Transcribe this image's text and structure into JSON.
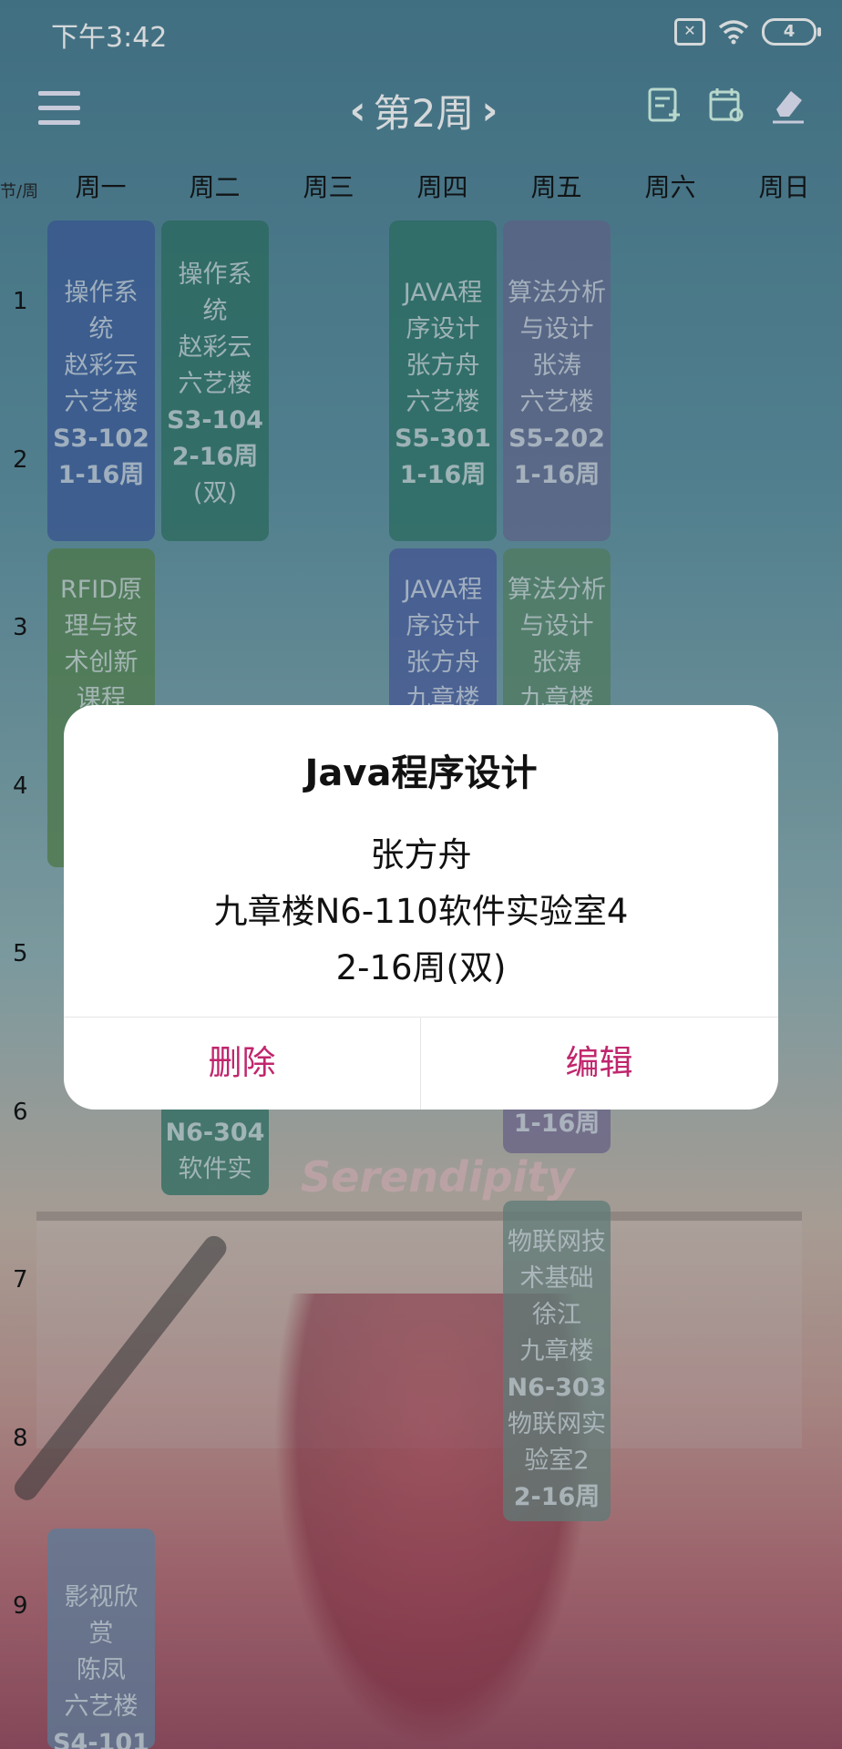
{
  "status_bar": {
    "time": "下午3:42",
    "sim_icon": "sim-off-icon",
    "battery_level": "4"
  },
  "toolbar": {
    "week_label": "第2周"
  },
  "grid": {
    "corner_label": "节/周",
    "days": [
      "周一",
      "周二",
      "周三",
      "周四",
      "周五",
      "周六",
      "周日"
    ],
    "sections": [
      "1",
      "2",
      "3",
      "4",
      "5",
      "6",
      "7",
      "8",
      "9"
    ]
  },
  "courses": [
    {
      "lines": [
        "操作系",
        "统",
        "赵彩云",
        "六艺楼"
      ],
      "bold": [
        "S3-102",
        "1-16周"
      ],
      "color": "#3f5ea4"
    },
    {
      "lines": [
        "操作系",
        "统",
        "赵彩云",
        "六艺楼"
      ],
      "bold": [
        "S3-104",
        "2-16周"
      ],
      "extra": "(双)",
      "color": "#2f7766"
    },
    {
      "lines": [
        "JAVA程",
        "序设计",
        "张方舟",
        "六艺楼"
      ],
      "bold": [
        "S5-301",
        "1-16周"
      ],
      "color": "#2f7a6a"
    },
    {
      "lines": [
        "算法分析",
        "与设计",
        "张涛",
        "六艺楼"
      ],
      "bold": [
        "S5-202",
        "1-16周"
      ],
      "color": "#6e6f98"
    },
    {
      "lines": [
        "RFID原",
        "理与技",
        "术创新",
        "课程"
      ],
      "color": "#5a8a4c"
    },
    {
      "lines": [
        "JAVA程",
        "序设计",
        "张方舟",
        "九章楼"
      ],
      "color": "#4e5fa8"
    },
    {
      "lines": [
        "算法分析",
        "与设计",
        "张涛",
        "九章楼"
      ],
      "color": "#5c8c68"
    },
    {
      "bold": [
        "N6-304"
      ],
      "lines": [
        "软件实"
      ],
      "color": "#2f7a68"
    },
    {
      "bold": [
        "1-16周"
      ],
      "color": "#7a6e98"
    },
    {
      "lines": [
        "物联网技",
        "术基础",
        "徐江",
        "九章楼"
      ],
      "bold": [
        "N6-303"
      ],
      "lines2": [
        "物联网实",
        "验室2"
      ],
      "bold2": [
        "2-16周"
      ],
      "color": "#6d8e86"
    },
    {
      "lines": [
        "影视欣",
        "赏",
        "陈凤",
        "六艺楼"
      ],
      "bold": [
        "S4-101"
      ],
      "color": "#6a8fb0"
    }
  ],
  "scene": {
    "sign_text": "Serendipity"
  },
  "dialog": {
    "title": "Java程序设计",
    "teacher": "张方舟",
    "location": "九章楼N6-110软件实验室4",
    "weeks": "2-16周(双)",
    "delete_label": "删除",
    "edit_label": "编辑"
  }
}
